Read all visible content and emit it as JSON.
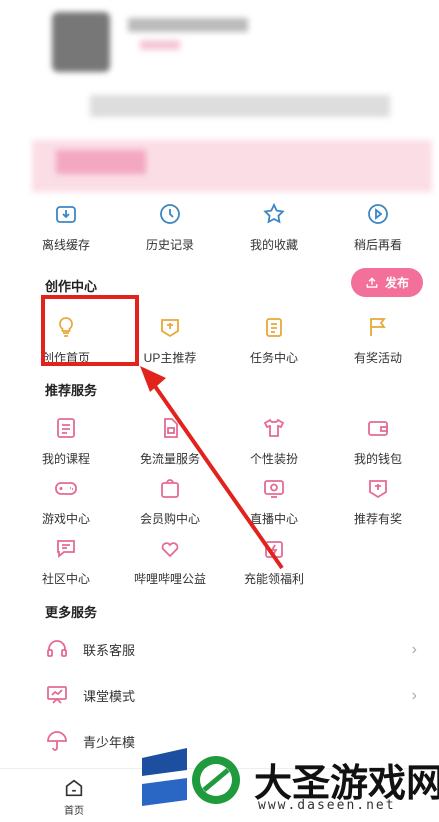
{
  "quick_actions": [
    {
      "label": "离线缓存",
      "icon": "download-icon"
    },
    {
      "label": "历史记录",
      "icon": "history-icon"
    },
    {
      "label": "我的收藏",
      "icon": "star-icon"
    },
    {
      "label": "稍后再看",
      "icon": "play-later-icon"
    }
  ],
  "create_center": {
    "title": "创作中心",
    "publish_label": "发布",
    "items": [
      {
        "label": "创作首页",
        "icon": "lightbulb-icon"
      },
      {
        "label": "UP主推荐",
        "icon": "award-icon"
      },
      {
        "label": "任务中心",
        "icon": "clipboard-icon"
      },
      {
        "label": "有奖活动",
        "icon": "flag-icon"
      }
    ]
  },
  "recommend_services": {
    "title": "推荐服务",
    "items": [
      {
        "label": "我的课程",
        "icon": "course-icon"
      },
      {
        "label": "免流量服务",
        "icon": "sim-icon"
      },
      {
        "label": "个性装扮",
        "icon": "tshirt-icon"
      },
      {
        "label": "我的钱包",
        "icon": "wallet-icon"
      },
      {
        "label": "游戏中心",
        "icon": "gamepad-icon"
      },
      {
        "label": "会员购中心",
        "icon": "shopping-bag-icon"
      },
      {
        "label": "直播中心",
        "icon": "tv-icon"
      },
      {
        "label": "推荐有奖",
        "icon": "reward-icon"
      },
      {
        "label": "社区中心",
        "icon": "chat-icon"
      },
      {
        "label": "哔哩哔哩公益",
        "icon": "heart-hands-icon"
      },
      {
        "label": "充能领福利",
        "icon": "battery-gift-icon"
      }
    ]
  },
  "more_services": {
    "title": "更多服务",
    "items": [
      {
        "label": "联系客服",
        "icon": "headset-icon"
      },
      {
        "label": "课堂模式",
        "icon": "classroom-icon"
      },
      {
        "label": "青少年模",
        "icon": "umbrella-icon"
      }
    ]
  },
  "bottom_nav": {
    "home_label": "首页"
  },
  "watermark": {
    "brand": "大圣游戏网",
    "url": "www.daseen.net"
  },
  "colors": {
    "accent": "#f2709a",
    "icon_blue": "#3c86c4",
    "icon_yellow": "#e8a838",
    "highlight": "#e2231d"
  }
}
